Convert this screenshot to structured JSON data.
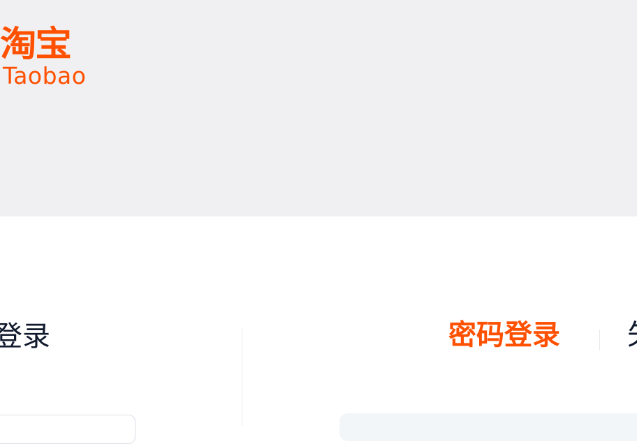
{
  "brand": {
    "logo_cn": "淘宝",
    "logo_en": "Taobao",
    "color": "#ff5000"
  },
  "left_panel": {
    "title": "登录"
  },
  "login_tabs": {
    "password_login": "密码登录",
    "sms_login_partial": "矢"
  },
  "colors": {
    "header_bg": "#f0f0f2",
    "active_tab": "#ff5000",
    "text_dark": "#11192d"
  }
}
